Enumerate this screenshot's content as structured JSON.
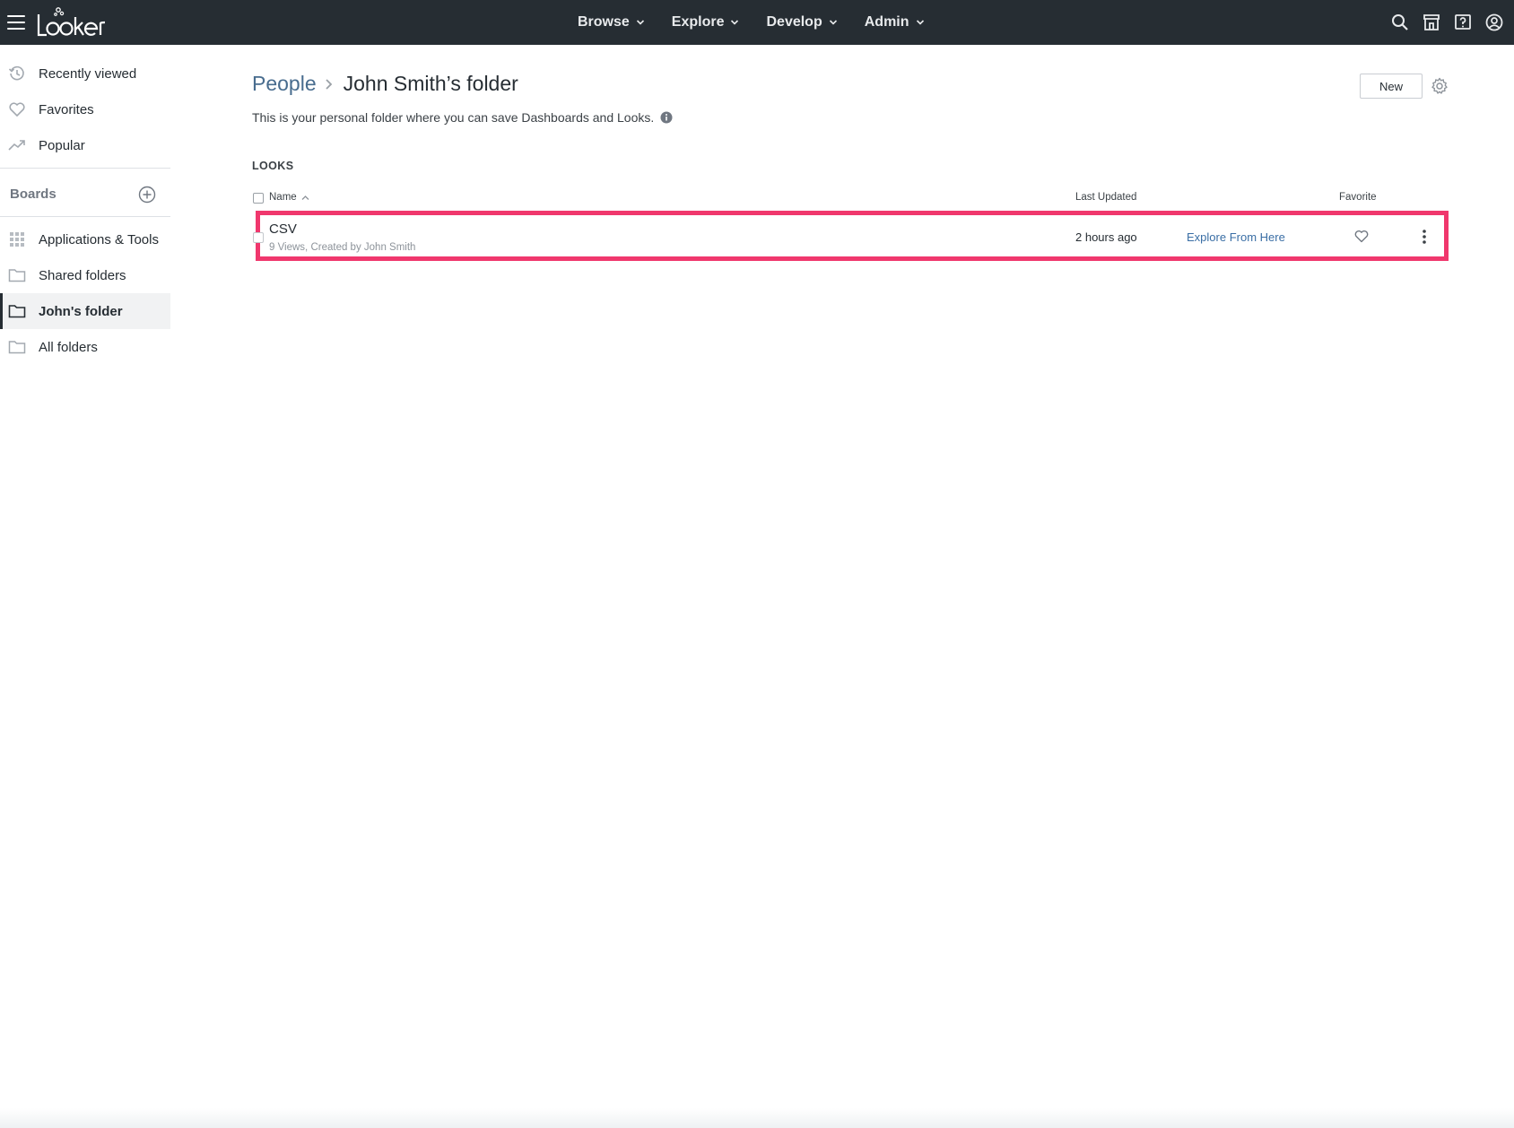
{
  "app": {
    "name": "Looker"
  },
  "nav": {
    "items": [
      {
        "label": "Browse"
      },
      {
        "label": "Explore"
      },
      {
        "label": "Develop"
      },
      {
        "label": "Admin"
      }
    ]
  },
  "sidebar": {
    "top_items": [
      {
        "label": "Recently viewed",
        "icon": "history-icon"
      },
      {
        "label": "Favorites",
        "icon": "heart-icon"
      },
      {
        "label": "Popular",
        "icon": "trending-icon"
      }
    ],
    "boards_label": "Boards",
    "folder_items": [
      {
        "label": "Applications & Tools",
        "icon": "grid-icon"
      },
      {
        "label": "Shared folders",
        "icon": "folder-icon"
      },
      {
        "label": "John's folder",
        "icon": "folder-icon",
        "active": true
      },
      {
        "label": "All folders",
        "icon": "folder-icon"
      }
    ]
  },
  "header": {
    "breadcrumb_parent": "People",
    "title": "John Smith’s folder",
    "subtitle": "This is your personal folder where you can save Dashboards and Looks.",
    "new_label": "New"
  },
  "looks": {
    "section_label": "LOOKS",
    "columns": {
      "name": "Name",
      "last_updated": "Last Updated",
      "favorite": "Favorite"
    },
    "rows": [
      {
        "title": "CSV",
        "meta": "9 Views, Created by John Smith",
        "last_updated": "2 hours ago",
        "action": "Explore From Here"
      }
    ]
  },
  "colors": {
    "topbar": "#262d33",
    "highlight": "#f0376d",
    "link": "#486c8e"
  }
}
